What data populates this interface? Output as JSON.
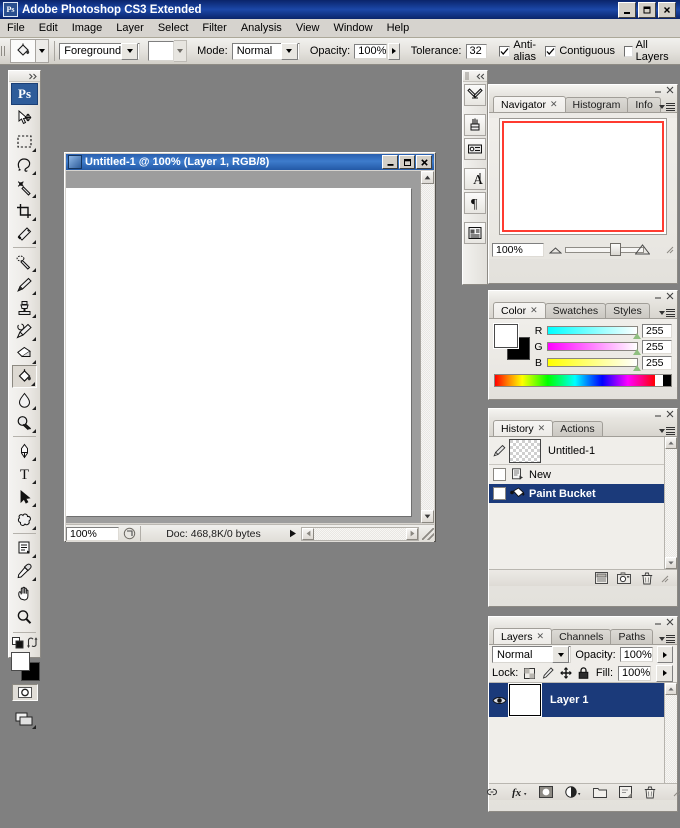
{
  "app": {
    "title": "Adobe Photoshop CS3 Extended",
    "icon": "photoshop-icon",
    "window_buttons": [
      "minimize",
      "restore",
      "close"
    ]
  },
  "menubar": {
    "items": [
      {
        "label": "File"
      },
      {
        "label": "Edit"
      },
      {
        "label": "Image"
      },
      {
        "label": "Layer"
      },
      {
        "label": "Select"
      },
      {
        "label": "Filter"
      },
      {
        "label": "Analysis"
      },
      {
        "label": "View"
      },
      {
        "label": "Window"
      },
      {
        "label": "Help"
      }
    ]
  },
  "options_bar": {
    "tool_icon": "paint-bucket-icon",
    "fill_source_label": "",
    "fill_source_value": "Foreground",
    "pattern_swatch": "pattern-picker",
    "mode_label": "Mode:",
    "mode_value": "Normal",
    "opacity_label": "Opacity:",
    "opacity_value": "100%",
    "tolerance_label": "Tolerance:",
    "tolerance_value": "32",
    "checkboxes": [
      {
        "label": "Anti-alias",
        "checked": true
      },
      {
        "label": "Contiguous",
        "checked": true
      },
      {
        "label": "All Layers",
        "checked": false
      }
    ]
  },
  "toolbox": {
    "logo": "Ps",
    "tools": [
      {
        "name": "move-tool",
        "selected": false,
        "has_flyout": false
      },
      {
        "name": "rectangular-marquee-tool",
        "selected": false,
        "has_flyout": true
      },
      {
        "name": "lasso-tool",
        "selected": false,
        "has_flyout": true
      },
      {
        "name": "magic-wand-tool",
        "selected": false,
        "has_flyout": true
      },
      {
        "name": "crop-tool",
        "selected": false,
        "has_flyout": true
      },
      {
        "name": "slice-tool",
        "selected": false,
        "has_flyout": true
      },
      {
        "name": "healing-brush-tool",
        "selected": false,
        "has_flyout": true
      },
      {
        "name": "brush-tool",
        "selected": false,
        "has_flyout": true
      },
      {
        "name": "clone-stamp-tool",
        "selected": false,
        "has_flyout": true
      },
      {
        "name": "history-brush-tool",
        "selected": false,
        "has_flyout": true
      },
      {
        "name": "eraser-tool",
        "selected": false,
        "has_flyout": true
      },
      {
        "name": "paint-bucket-tool",
        "selected": true,
        "has_flyout": true
      },
      {
        "name": "blur-tool",
        "selected": false,
        "has_flyout": true
      },
      {
        "name": "dodge-tool",
        "selected": false,
        "has_flyout": true
      },
      {
        "name": "pen-tool",
        "selected": false,
        "has_flyout": true
      },
      {
        "name": "type-tool",
        "selected": false,
        "has_flyout": true
      },
      {
        "name": "path-selection-tool",
        "selected": false,
        "has_flyout": true
      },
      {
        "name": "custom-shape-tool",
        "selected": false,
        "has_flyout": true
      },
      {
        "name": "notes-tool",
        "selected": false,
        "has_flyout": true
      },
      {
        "name": "eyedropper-tool",
        "selected": false,
        "has_flyout": true
      },
      {
        "name": "hand-tool",
        "selected": false,
        "has_flyout": false
      },
      {
        "name": "zoom-tool",
        "selected": false,
        "has_flyout": false
      }
    ],
    "foreground_color": "#ffffff",
    "background_color": "#000000",
    "quick_mask": "edit-in-quick-mask-mode",
    "screen_mode": "change-screen-mode"
  },
  "vertical_dock": {
    "items": [
      {
        "name": "tool-presets-icon"
      },
      {
        "name": "brushes-icon"
      },
      {
        "name": "clone-source-icon"
      },
      {
        "name": "character-icon",
        "glyph": "A"
      },
      {
        "name": "paragraph-icon",
        "glyph": "¶"
      },
      {
        "name": "layer-comps-icon"
      }
    ]
  },
  "document": {
    "title": "Untitled-1 @ 100% (Layer 1, RGB/8)",
    "window_buttons": [
      "minimize",
      "restore",
      "close"
    ],
    "zoom": "100%",
    "status": "Doc: 468,8K/0 bytes",
    "canvas_color": "#ffffff"
  },
  "navigator_panel": {
    "tabs": [
      {
        "label": "Navigator",
        "active": true,
        "closable": true
      },
      {
        "label": "Histogram",
        "active": false,
        "closable": false
      },
      {
        "label": "Info",
        "active": false,
        "closable": false
      }
    ],
    "zoom_value": "100%",
    "view_box_color": "#ff3b30"
  },
  "color_panel": {
    "tabs": [
      {
        "label": "Color",
        "active": true,
        "closable": true
      },
      {
        "label": "Swatches",
        "active": false,
        "closable": false
      },
      {
        "label": "Styles",
        "active": false,
        "closable": false
      }
    ],
    "foreground": "#ffffff",
    "background": "#000000",
    "channels": [
      {
        "label": "R",
        "value": "255"
      },
      {
        "label": "G",
        "value": "255"
      },
      {
        "label": "B",
        "value": "255"
      }
    ]
  },
  "history_panel": {
    "tabs": [
      {
        "label": "History",
        "active": true,
        "closable": true
      },
      {
        "label": "Actions",
        "active": false,
        "closable": false
      }
    ],
    "snapshot": "Untitled-1",
    "states": [
      {
        "label": "New",
        "icon": "new-document-icon",
        "selected": false
      },
      {
        "label": "Paint Bucket",
        "icon": "paint-bucket-icon",
        "selected": true
      }
    ],
    "footer_buttons": [
      {
        "name": "create-document-from-state-button"
      },
      {
        "name": "create-new-snapshot-button"
      },
      {
        "name": "delete-state-button"
      }
    ]
  },
  "layers_panel": {
    "tabs": [
      {
        "label": "Layers",
        "active": true,
        "closable": true
      },
      {
        "label": "Channels",
        "active": false,
        "closable": false
      },
      {
        "label": "Paths",
        "active": false,
        "closable": false
      }
    ],
    "blend_mode": "Normal",
    "opacity_label": "Opacity:",
    "opacity_value": "100%",
    "lock_label": "Lock:",
    "lock_icons": [
      "lock-transparency-icon",
      "lock-image-icon",
      "lock-position-icon",
      "lock-all-icon"
    ],
    "fill_label": "Fill:",
    "fill_value": "100%",
    "layers": [
      {
        "name": "Layer 1",
        "visible": true,
        "selected": true
      }
    ],
    "footer_buttons": [
      {
        "name": "link-layers-button"
      },
      {
        "name": "add-layer-style-button",
        "glyph": "fx"
      },
      {
        "name": "add-layer-mask-button"
      },
      {
        "name": "new-adjustment-layer-button"
      },
      {
        "name": "new-group-button"
      },
      {
        "name": "new-layer-button"
      },
      {
        "name": "delete-layer-button"
      }
    ]
  }
}
